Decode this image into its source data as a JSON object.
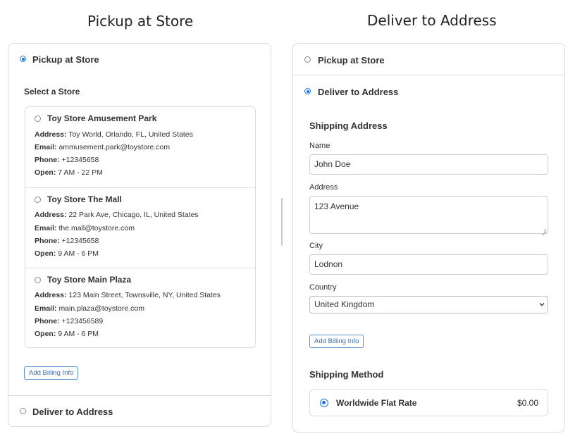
{
  "left": {
    "title": "Pickup at Store",
    "pickup_option": "Pickup at Store",
    "select_store_title": "Select a Store",
    "stores": [
      {
        "name": "Toy Store Amusement Park",
        "address_label": "Address:",
        "address": "Toy World, Orlando, FL, United States",
        "email_label": "Email:",
        "email": "ammusement.park@toystore.com",
        "phone_label": "Phone:",
        "phone": "+12345658",
        "open_label": "Open:",
        "open": "7 AM - 22 PM"
      },
      {
        "name": "Toy Store The Mall",
        "address_label": "Address:",
        "address": "22 Park Ave, Chicago, IL, United States",
        "email_label": "Email:",
        "email": "the.mall@toystore.com",
        "phone_label": "Phone:",
        "phone": "+12345658",
        "open_label": "Open:",
        "open": "9 AM - 6 PM"
      },
      {
        "name": "Toy Store Main Plaza",
        "address_label": "Address:",
        "address": "123 Main Street, Townsville, NY, United States",
        "email_label": "Email:",
        "email": "main.plaza@toystore.com",
        "phone_label": "Phone:",
        "phone": "+123456589",
        "open_label": "Open:",
        "open": "9 AM - 6 PM"
      }
    ],
    "add_billing_label": "Add Billing Info",
    "deliver_option": "Deliver to Address"
  },
  "right": {
    "title": "Deliver to Address",
    "pickup_option": "Pickup at Store",
    "deliver_option": "Deliver to Address",
    "shipping_address_title": "Shipping Address",
    "name_label": "Name",
    "name_value": "John Doe",
    "address_label": "Address",
    "address_value": "123 Avenue",
    "city_label": "City",
    "city_value": "Lodnon",
    "country_label": "Country",
    "country_value": "United Kingdom",
    "add_billing_label": "Add Billing Info",
    "shipping_method_title": "Shipping Method",
    "method_name": "Worldwide Flat Rate",
    "method_price": "$0.00"
  },
  "colors": {
    "accent": "#1a73e8",
    "border": "#dcdcdc",
    "button_border": "#5a8fd0"
  }
}
